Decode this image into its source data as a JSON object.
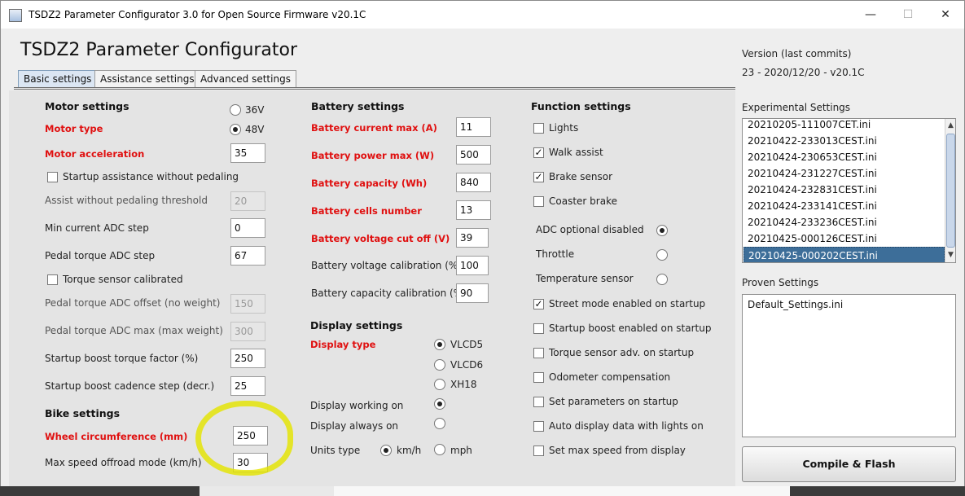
{
  "window": {
    "title": "TSDZ2 Parameter Configurator 3.0 for Open Source Firmware v20.1C",
    "minimize_icon": "minimize-icon",
    "maximize_icon": "maximize-icon",
    "close_icon": "close-icon"
  },
  "header": {
    "title": "TSDZ2 Parameter Configurator"
  },
  "tabs": [
    {
      "label": "Basic settings",
      "active": true
    },
    {
      "label": "Assistance settings",
      "active": false
    },
    {
      "label": "Advanced settings",
      "active": false
    }
  ],
  "motor": {
    "section_title": "Motor settings",
    "motor_type_label": "Motor type",
    "motor_type_options": [
      {
        "label": "36V",
        "selected": false
      },
      {
        "label": "48V",
        "selected": true
      }
    ],
    "acceleration_label": "Motor acceleration",
    "acceleration_value": "35",
    "startup_assist_label": "Startup assistance without pedaling",
    "startup_assist_checked": false,
    "assist_threshold_label": "Assist without pedaling threshold",
    "assist_threshold_value": "20",
    "min_current_label": "Min current ADC step",
    "min_current_value": "0",
    "pedal_torque_step_label": "Pedal torque ADC step",
    "pedal_torque_step_value": "67",
    "torque_calibrated_label": "Torque sensor calibrated",
    "torque_calibrated_checked": false,
    "torque_offset_label": "Pedal torque ADC offset (no weight)",
    "torque_offset_value": "150",
    "torque_max_label": "Pedal torque ADC max (max weight)",
    "torque_max_value": "300",
    "boost_factor_label": "Startup boost torque factor (%)",
    "boost_factor_value": "250",
    "boost_cadence_label": "Startup boost cadence step (decr.)",
    "boost_cadence_value": "25"
  },
  "bike": {
    "section_title": "Bike settings",
    "wheel_label": "Wheel circumference (mm)",
    "wheel_value": "250",
    "offroad_label": "Max speed offroad mode (km/h)",
    "offroad_value": "30"
  },
  "battery": {
    "section_title": "Battery settings",
    "current_label": "Battery current max (A)",
    "current_value": "11",
    "power_label": "Battery power max (W)",
    "power_value": "500",
    "capacity_label": "Battery capacity (Wh)",
    "capacity_value": "840",
    "cells_label": "Battery cells number",
    "cells_value": "13",
    "cutoff_label": "Battery voltage cut off (V)",
    "cutoff_value": "39",
    "volt_cal_label": "Battery voltage calibration (%)",
    "volt_cal_value": "100",
    "cap_cal_label": "Battery capacity calibration (%)",
    "cap_cal_value": "90"
  },
  "display": {
    "section_title": "Display settings",
    "type_label": "Display type",
    "type_options": [
      {
        "label": "VLCD5",
        "selected": true
      },
      {
        "label": "VLCD6",
        "selected": false
      },
      {
        "label": "XH18",
        "selected": false
      }
    ],
    "working_on_label": "Display working on",
    "working_on_selected": true,
    "always_on_label": "Display always on",
    "always_on_selected": false,
    "units_label": "Units type",
    "units_options": [
      {
        "label": "km/h",
        "selected": true
      },
      {
        "label": "mph",
        "selected": false
      }
    ]
  },
  "function": {
    "section_title": "Function settings",
    "checks_top": [
      {
        "label": "Lights",
        "checked": false
      },
      {
        "label": "Walk assist",
        "checked": true
      },
      {
        "label": "Brake sensor",
        "checked": true
      },
      {
        "label": "Coaster brake",
        "checked": false
      }
    ],
    "radios": [
      {
        "label": "ADC optional disabled",
        "selected": true
      },
      {
        "label": "Throttle",
        "selected": false
      },
      {
        "label": "Temperature sensor",
        "selected": false
      }
    ],
    "checks_bottom": [
      {
        "label": "Street mode enabled on startup",
        "checked": true
      },
      {
        "label": "Startup boost enabled  on startup",
        "checked": false
      },
      {
        "label": "Torque sensor adv. on startup",
        "checked": false
      },
      {
        "label": "Odometer compensation",
        "checked": false
      },
      {
        "label": "Set parameters on startup",
        "checked": false
      },
      {
        "label": "Auto display data with lights on",
        "checked": false
      },
      {
        "label": "Set max speed from display",
        "checked": false
      }
    ]
  },
  "sidebar": {
    "version_label": "Version (last commits)",
    "version_value": "23 - 2020/12/20 - v20.1C",
    "experimental_label": "Experimental Settings",
    "experimental_items": [
      "20210205-111007CET.ini",
      "20210422-233013CEST.ini",
      "20210424-230653CEST.ini",
      "20210424-231227CEST.ini",
      "20210424-232831CEST.ini",
      "20210424-233141CEST.ini",
      "20210424-233236CEST.ini",
      "20210425-000126CEST.ini",
      "20210425-000202CEST.ini"
    ],
    "experimental_selected_index": 8,
    "proven_label": "Proven Settings",
    "proven_items": [
      "Default_Settings.ini"
    ],
    "compile_button": "Compile & Flash"
  },
  "colors": {
    "required_label": "#e01010",
    "selection": "#3d6e99",
    "highlight_marker": "#e4e400"
  }
}
